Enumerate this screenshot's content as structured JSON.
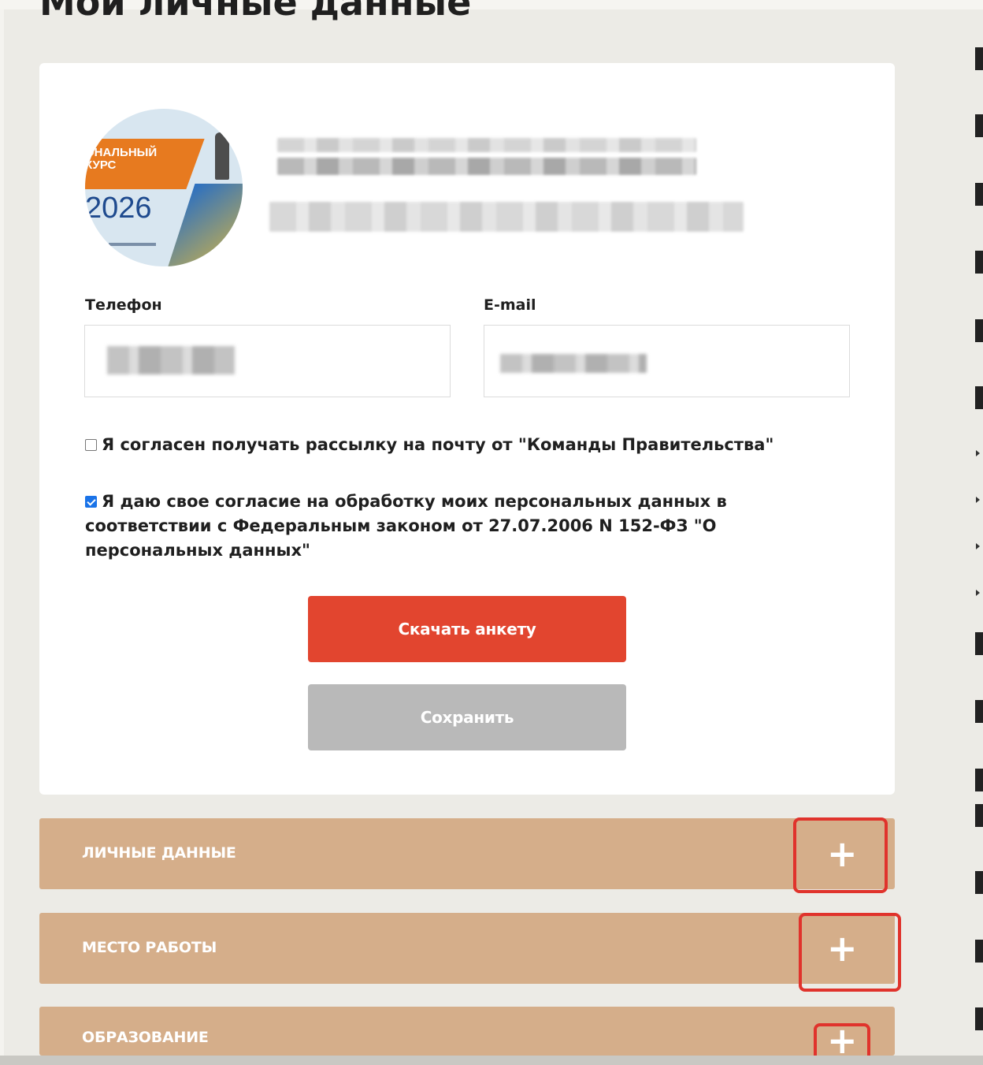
{
  "page": {
    "title": "Мои личные данные"
  },
  "profile": {
    "logo": {
      "text": "ОНАЛЬНЫЙ КУРС",
      "year": "2026"
    }
  },
  "contacts": {
    "phone_label": "Телефон",
    "email_label": "E-mail"
  },
  "consents": {
    "newsletter": {
      "label": "Я согласен получать рассылку на почту от \"Команды Правительства\"",
      "checked": false
    },
    "personal_data": {
      "label": "Я даю свое согласие на обработку моих персональных данных в соответствии с Федеральным законом от 27.07.2006 N 152-ФЗ \"О персональных данных\"",
      "checked": true
    }
  },
  "buttons": {
    "download": "Скачать анкету",
    "save": "Сохранить"
  },
  "sections": [
    {
      "label": "ЛИЧНЫЕ ДАННЫЕ",
      "toggle": "+"
    },
    {
      "label": "МЕСТО РАБОТЫ",
      "toggle": "+"
    },
    {
      "label": "ОБРАЗОВАНИЕ",
      "toggle": "+"
    }
  ],
  "colors": {
    "accent_red": "#e2452f",
    "section_bg": "#d5ae8a",
    "highlight": "#e0332c",
    "disabled_button": "#b9b9b9"
  }
}
